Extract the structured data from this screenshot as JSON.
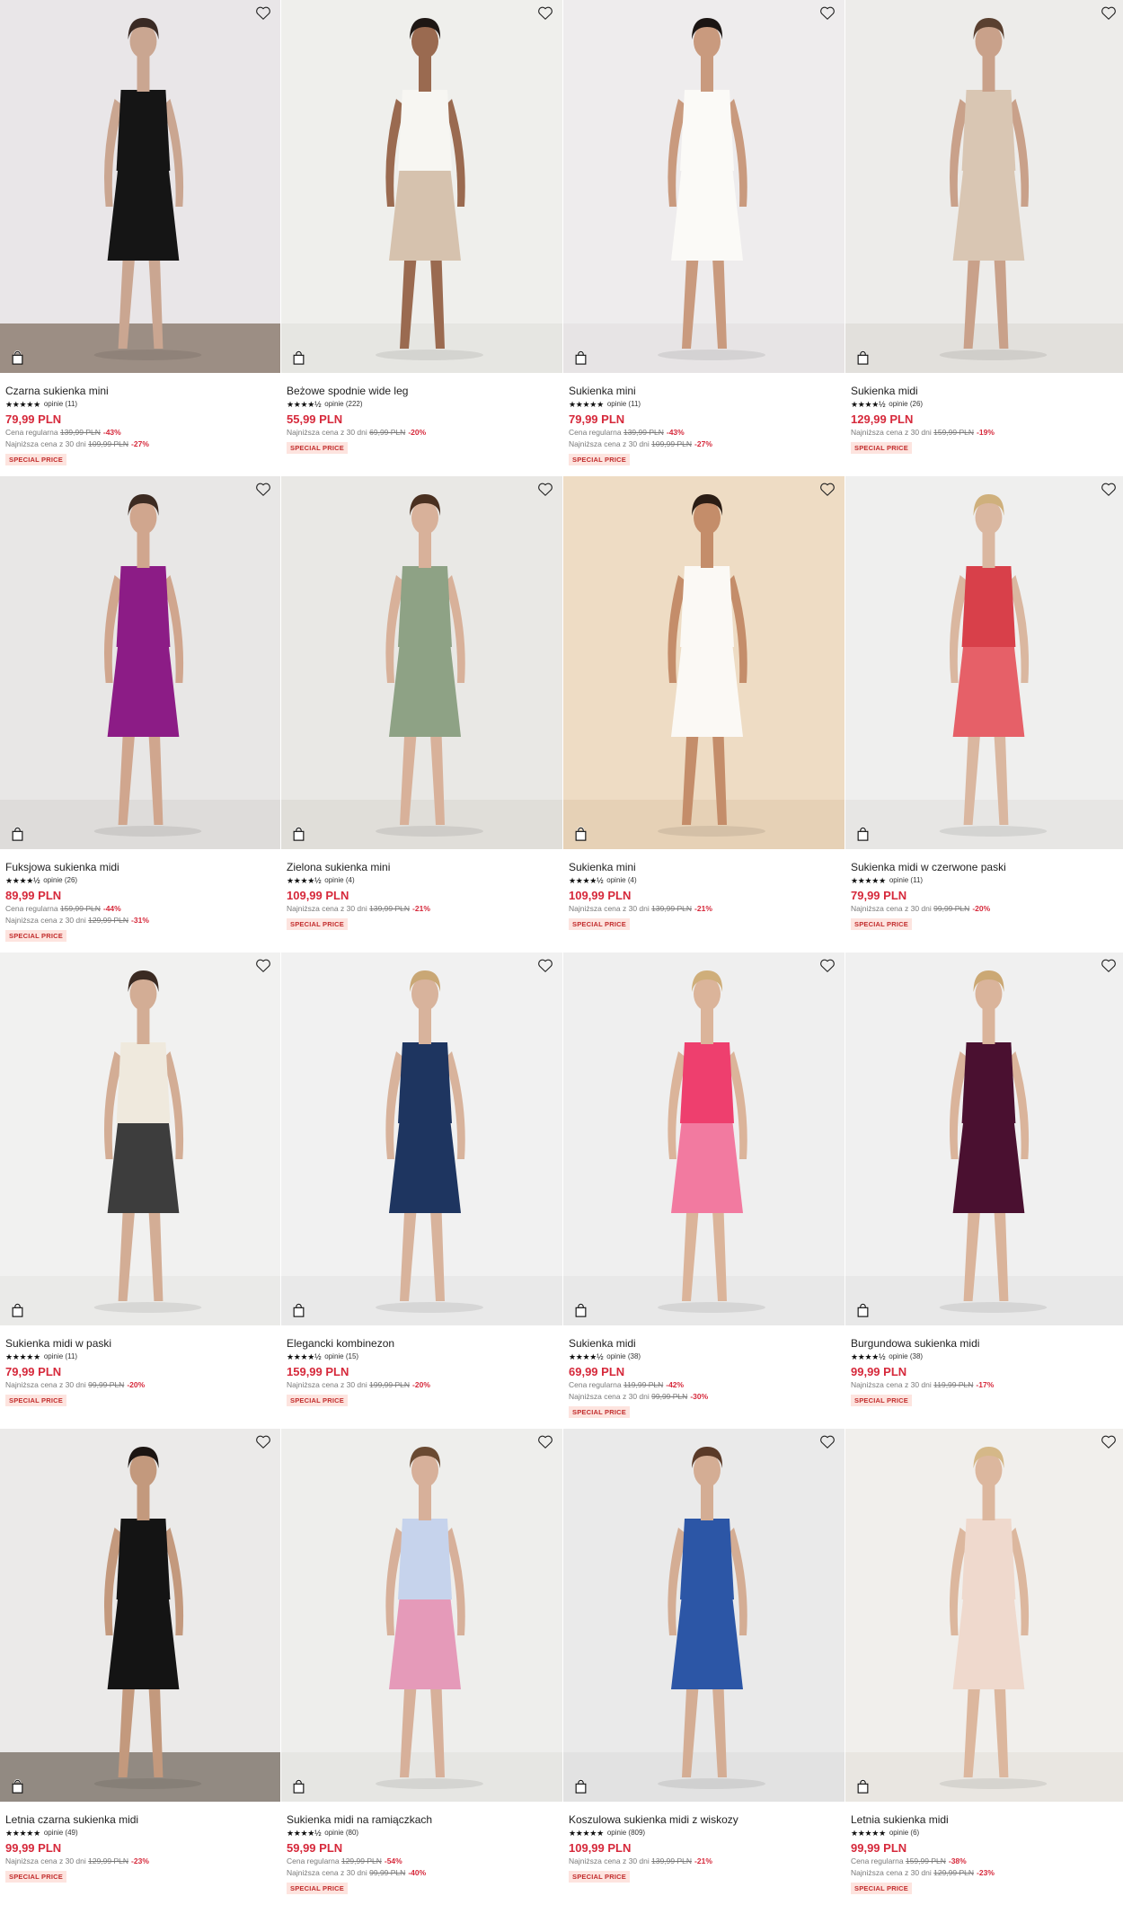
{
  "products": [
    {
      "name": "Czarna sukienka mini",
      "stars": "★★★★★",
      "reviews": "opinie (11)",
      "price": "79,99 PLN",
      "notes": [
        {
          "label": "Cena regularna",
          "old": "139,99 PLN",
          "pct": "-43%"
        },
        {
          "label": "Najniższa cena z 30 dni",
          "old": "109,99 PLN",
          "pct": "-27%"
        }
      ],
      "badge": "SPECIAL PRICE",
      "colors": {
        "bg": "#e9e6e8",
        "floor": "#9c8e84",
        "skin": "#caa691",
        "hair": "#3a2a24",
        "top": "#151515",
        "bottom": "#151515"
      }
    },
    {
      "name": "Beżowe spodnie wide leg",
      "stars": "★★★★½",
      "reviews": "opinie (222)",
      "price": "55,99 PLN",
      "notes": [
        {
          "label": "Najniższa cena z 30 dni",
          "old": "69,99 PLN",
          "pct": "-20%"
        }
      ],
      "badge": "SPECIAL PRICE",
      "colors": {
        "bg": "#efefec",
        "floor": "#e6e6e2",
        "skin": "#9a6a50",
        "hair": "#1e1714",
        "top": "#f7f6f2",
        "bottom": "#d6c2ae"
      }
    },
    {
      "name": "Sukienka mini",
      "stars": "★★★★★",
      "reviews": "opinie (11)",
      "price": "79,99 PLN",
      "notes": [
        {
          "label": "Cena regularna",
          "old": "139,99 PLN",
          "pct": "-43%"
        },
        {
          "label": "Najniższa cena z 30 dni",
          "old": "109,99 PLN",
          "pct": "-27%"
        }
      ],
      "badge": "SPECIAL PRICE",
      "colors": {
        "bg": "#eeeced",
        "floor": "#e7e4e5",
        "skin": "#c99a7e",
        "hair": "#1b1513",
        "top": "#fbfaf7",
        "bottom": "#fbfaf7"
      }
    },
    {
      "name": "Sukienka midi",
      "stars": "★★★★½",
      "reviews": "opinie (26)",
      "price": "129,99 PLN",
      "notes": [
        {
          "label": "Najniższa cena z 30 dni",
          "old": "159,99 PLN",
          "pct": "-19%"
        }
      ],
      "badge": "SPECIAL PRICE",
      "colors": {
        "bg": "#edecea",
        "floor": "#e2e0dc",
        "skin": "#c9a18a",
        "hair": "#5a4030",
        "top": "#d9c6b3",
        "bottom": "#d9c6b3"
      }
    },
    {
      "name": "Fuksjowa sukienka midi",
      "stars": "★★★★½",
      "reviews": "opinie (26)",
      "price": "89,99 PLN",
      "notes": [
        {
          "label": "Cena regularna",
          "old": "159,99 PLN",
          "pct": "-44%"
        },
        {
          "label": "Najniższa cena z 30 dni",
          "old": "129,99 PLN",
          "pct": "-31%"
        }
      ],
      "badge": "SPECIAL PRICE",
      "colors": {
        "bg": "#e8e7e6",
        "floor": "#dedcda",
        "skin": "#d0a68e",
        "hair": "#3c2b22",
        "top": "#8c1c86",
        "bottom": "#8c1c86"
      }
    },
    {
      "name": "Zielona sukienka mini",
      "stars": "★★★★½",
      "reviews": "opinie (4)",
      "price": "109,99 PLN",
      "notes": [
        {
          "label": "Najniższa cena z 30 dni",
          "old": "139,99 PLN",
          "pct": "-21%"
        }
      ],
      "badge": "SPECIAL PRICE",
      "colors": {
        "bg": "#e9e8e5",
        "floor": "#e0ded9",
        "skin": "#d8b19a",
        "hair": "#4a3020",
        "top": "#8ea285",
        "bottom": "#8ea285"
      }
    },
    {
      "name": "Sukienka mini",
      "stars": "★★★★½",
      "reviews": "opinie (4)",
      "price": "109,99 PLN",
      "notes": [
        {
          "label": "Najniższa cena z 30 dni",
          "old": "139,99 PLN",
          "pct": "-21%"
        }
      ],
      "badge": "SPECIAL PRICE",
      "colors": {
        "bg": "#eedcc4",
        "floor": "#e6d1b6",
        "skin": "#c48d6a",
        "hair": "#2a1c14",
        "top": "#fbf9f5",
        "bottom": "#fbf9f5"
      }
    },
    {
      "name": "Sukienka midi w czerwone paski",
      "stars": "★★★★★",
      "reviews": "opinie (11)",
      "price": "79,99 PLN",
      "notes": [
        {
          "label": "Najniższa cena z 30 dni",
          "old": "99,99 PLN",
          "pct": "-20%"
        }
      ],
      "badge": "SPECIAL PRICE",
      "colors": {
        "bg": "#efefee",
        "floor": "#e7e6e4",
        "skin": "#dab7a0",
        "hair": "#cfb07c",
        "top": "#d8404a",
        "bottom": "#e66068"
      }
    },
    {
      "name": "Sukienka midi w paski",
      "stars": "★★★★★",
      "reviews": "opinie (11)",
      "price": "79,99 PLN",
      "notes": [
        {
          "label": "Najniższa cena z 30 dni",
          "old": "99,99 PLN",
          "pct": "-20%"
        }
      ],
      "badge": "SPECIAL PRICE",
      "colors": {
        "bg": "#f1f1f0",
        "floor": "#eaeae8",
        "skin": "#d3ad95",
        "hair": "#3a2a22",
        "top": "#efe9dd",
        "bottom": "#3d3d3d"
      }
    },
    {
      "name": "Elegancki kombinezon",
      "stars": "★★★★½",
      "reviews": "opinie (15)",
      "price": "159,99 PLN",
      "notes": [
        {
          "label": "Najniższa cena z 30 dni",
          "old": "199,99 PLN",
          "pct": "-20%"
        }
      ],
      "badge": "SPECIAL PRICE",
      "colors": {
        "bg": "#f1f1f1",
        "floor": "#e9e9e9",
        "skin": "#d8b39c",
        "hair": "#c9a775",
        "top": "#1e3560",
        "bottom": "#1e3560"
      }
    },
    {
      "name": "Sukienka midi",
      "stars": "★★★★½",
      "reviews": "opinie (38)",
      "price": "69,99 PLN",
      "notes": [
        {
          "label": "Cena regularna",
          "old": "119,99 PLN",
          "pct": "-42%"
        },
        {
          "label": "Najniższa cena z 30 dni",
          "old": "99,99 PLN",
          "pct": "-30%"
        }
      ],
      "badge": "SPECIAL PRICE",
      "colors": {
        "bg": "#efefef",
        "floor": "#e8e8e8",
        "skin": "#dbb49a",
        "hair": "#cfae7a",
        "top": "#ee3f6e",
        "bottom": "#f27aa0"
      }
    },
    {
      "name": "Burgundowa sukienka midi",
      "stars": "★★★★½",
      "reviews": "opinie (38)",
      "price": "99,99 PLN",
      "notes": [
        {
          "label": "Najniższa cena z 30 dni",
          "old": "119,99 PLN",
          "pct": "-17%"
        }
      ],
      "badge": "SPECIAL PRICE",
      "colors": {
        "bg": "#f0f0f0",
        "floor": "#e8e8e8",
        "skin": "#dab49b",
        "hair": "#cba874",
        "top": "#4a1030",
        "bottom": "#4a1030"
      }
    },
    {
      "name": "Letnia czarna sukienka midi",
      "stars": "★★★★★",
      "reviews": "opinie (49)",
      "price": "99,99 PLN",
      "notes": [
        {
          "label": "Najniższa cena z 30 dni",
          "old": "129,99 PLN",
          "pct": "-23%"
        }
      ],
      "badge": "SPECIAL PRICE",
      "colors": {
        "bg": "#ebeae9",
        "floor": "#928a82",
        "skin": "#c3997d",
        "hair": "#1c1512",
        "top": "#141414",
        "bottom": "#141414"
      }
    },
    {
      "name": "Sukienka midi na ramiączkach",
      "stars": "★★★★½",
      "reviews": "opinie (80)",
      "price": "59,99 PLN",
      "notes": [
        {
          "label": "Cena regularna",
          "old": "129,99 PLN",
          "pct": "-54%"
        },
        {
          "label": "Najniższa cena z 30 dni",
          "old": "99,99 PLN",
          "pct": "-40%"
        }
      ],
      "badge": "SPECIAL PRICE",
      "colors": {
        "bg": "#eeeeec",
        "floor": "#e6e6e3",
        "skin": "#d7b09a",
        "hair": "#6a4a32",
        "top": "#c6d3ec",
        "bottom": "#e59ab9"
      }
    },
    {
      "name": "Koszulowa sukienka midi z wiskozy",
      "stars": "★★★★★",
      "reviews": "opinie (809)",
      "price": "109,99 PLN",
      "notes": [
        {
          "label": "Najniższa cena z 30 dni",
          "old": "139,99 PLN",
          "pct": "-21%"
        }
      ],
      "badge": "SPECIAL PRICE",
      "colors": {
        "bg": "#eaeaea",
        "floor": "#e2e2e2",
        "skin": "#d4ad94",
        "hair": "#5a3a28",
        "top": "#2c56a6",
        "bottom": "#2c56a6"
      }
    },
    {
      "name": "Letnia sukienka midi",
      "stars": "★★★★★",
      "reviews": "opinie (6)",
      "price": "99,99 PLN",
      "notes": [
        {
          "label": "Cena regularna",
          "old": "159,99 PLN",
          "pct": "-38%"
        },
        {
          "label": "Najniższa cena z 30 dni",
          "old": "129,99 PLN",
          "pct": "-23%"
        }
      ],
      "badge": "SPECIAL PRICE",
      "colors": {
        "bg": "#f1efec",
        "floor": "#e9e6e1",
        "skin": "#dcb79e",
        "hair": "#d5b888",
        "top": "#efd9cd",
        "bottom": "#efd9cd"
      }
    }
  ]
}
